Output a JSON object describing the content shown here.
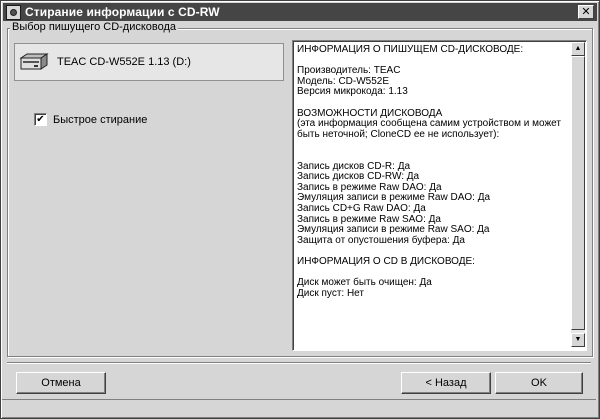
{
  "window": {
    "title": "Стирание информации с CD-RW"
  },
  "writer_group": {
    "legend": "Выбор пишущего CD-дисковода",
    "drive_label": "TEAC CD-W552E 1.13 (D:)"
  },
  "options": {
    "quick_erase_label": "Быстрое стирание",
    "quick_erase_checked": true,
    "check_mark": "✔"
  },
  "info_lines": [
    "ИНФОРМАЦИЯ О ПИШУЩЕМ CD-ДИСКОВОДЕ:",
    "",
    "Производитель: TEAC",
    "Модель: CD-W552E",
    "Версия микрокода: 1.13",
    "",
    "ВОЗМОЖНОСТИ ДИСКОВОДА",
    "(эта информация сообщена самим устройством и может",
    "быть неточной; CloneCD ее не использует):",
    "",
    "",
    "Запись дисков CD-R: Да",
    "Запись дисков CD-RW: Да",
    "Запись в режиме Raw DAO: Да",
    "Эмуляция записи в режиме Raw DAO: Да",
    "Запись CD+G Raw DAO: Да",
    "Запись в режиме Raw SAO: Да",
    "Эмуляция записи в режиме Raw SAO: Да",
    "Защита от опустошения буфера: Да",
    "",
    "ИНФОРМАЦИЯ О CD В ДИСКОВОДЕ:",
    "",
    "Диск может быть очищен: Да",
    "Диск пуст: Нет"
  ],
  "buttons": {
    "cancel": "Отмена",
    "back": "< Назад",
    "ok": "OK"
  },
  "glyphs": {
    "close": "✕",
    "scroll_up": "▲",
    "scroll_down": "▼"
  }
}
